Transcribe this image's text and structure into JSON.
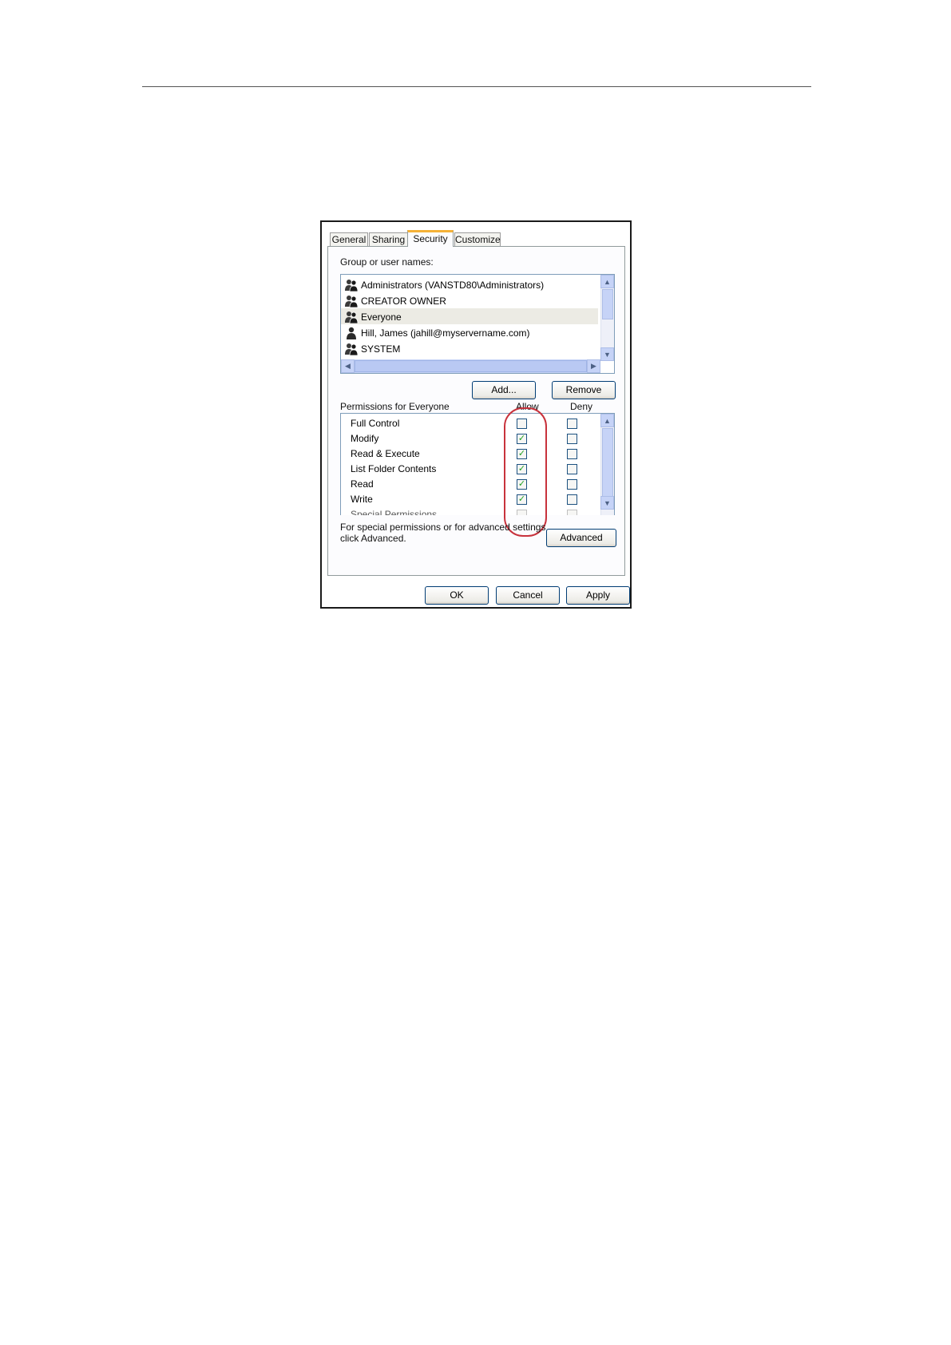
{
  "tabs": [
    "General",
    "Sharing",
    "Security",
    "Customize"
  ],
  "active_tab": "Security",
  "group_label": "Group or user names:",
  "users": [
    {
      "name": "Administrators (VANSTD80\\Administrators)",
      "icon": "group-icon"
    },
    {
      "name": "CREATOR OWNER",
      "icon": "group-icon"
    },
    {
      "name": "Everyone",
      "icon": "group-icon",
      "selected": true
    },
    {
      "name": "Hill, James (jahill@myservername.com)",
      "icon": "user-icon"
    },
    {
      "name": "SYSTEM",
      "icon": "group-icon"
    }
  ],
  "buttons": {
    "add": "Add...",
    "remove": "Remove",
    "advanced": "Advanced",
    "ok": "OK",
    "cancel": "Cancel",
    "apply": "Apply"
  },
  "permissions_label": "Permissions for Everyone",
  "col_allow": "Allow",
  "col_deny": "Deny",
  "permissions": [
    {
      "name": "Full Control",
      "allow": false,
      "deny": false
    },
    {
      "name": "Modify",
      "allow": true,
      "deny": false
    },
    {
      "name": "Read & Execute",
      "allow": true,
      "deny": false
    },
    {
      "name": "List Folder Contents",
      "allow": true,
      "deny": false
    },
    {
      "name": "Read",
      "allow": true,
      "deny": false
    },
    {
      "name": "Write",
      "allow": true,
      "deny": false
    },
    {
      "name": "Special Permissions",
      "allow": false,
      "deny": false
    }
  ],
  "advanced_note_line1": "For special permissions or for advanced settings,",
  "advanced_note_line2": "click Advanced.",
  "colors": {
    "highlight_oval": "#c8323c",
    "check": "#21a121",
    "tab_accent": "#f5b238"
  }
}
